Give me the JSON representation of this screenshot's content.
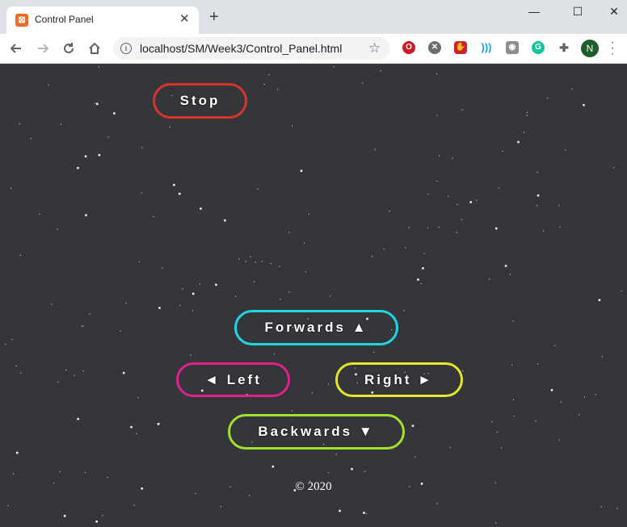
{
  "browser": {
    "tab_title": "Control Panel",
    "tab_close": "✕",
    "new_tab": "+",
    "window_controls": {
      "minimize": "—",
      "maximize": "☐",
      "close": "✕"
    },
    "url": "localhost/SM/Week3/Control_Panel.html",
    "profile_initial": "N",
    "extension_icons": [
      "opera-icon",
      "close-circle-icon",
      "adblock-icon",
      "wifi-signal-icon",
      "camera-icon",
      "grammarly-icon",
      "puzzle-icon"
    ]
  },
  "page": {
    "background": "#35363a",
    "buttons": {
      "stop": {
        "label": "Stop",
        "color": "#d8342a"
      },
      "forwards": {
        "label": "Forwards ▲",
        "color": "#20d6e3"
      },
      "left": {
        "label": "◄ Left",
        "color": "#e0208c"
      },
      "right": {
        "label": "Right ►",
        "color": "#e5e52a"
      },
      "backwards": {
        "label": "Backwards ▼",
        "color": "#a2e22c"
      }
    },
    "footer": "© 2020"
  }
}
